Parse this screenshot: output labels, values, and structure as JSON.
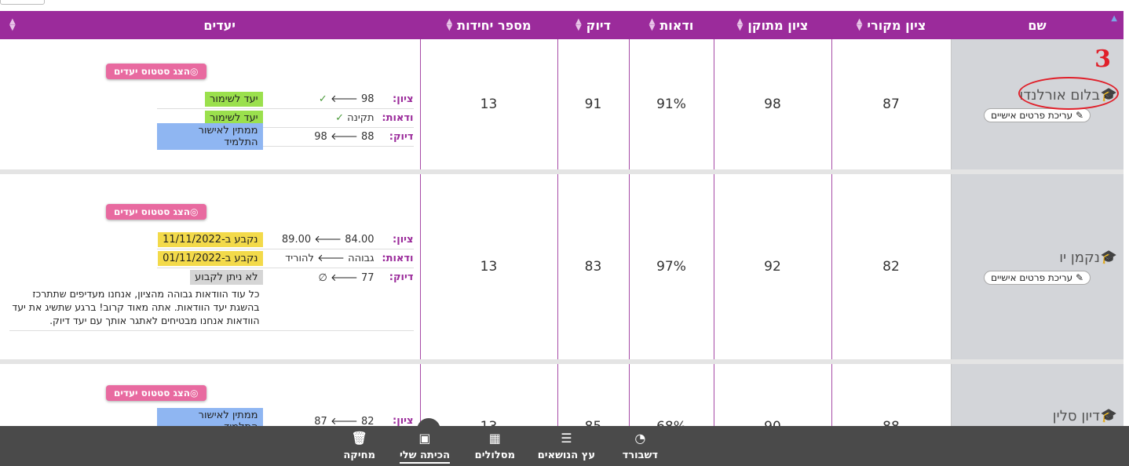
{
  "columns": {
    "name": "שם",
    "orig_grade": "ציון מקורי",
    "fixed_grade": "ציון מתוקן",
    "confidence": "ודאות",
    "accuracy": "דיוק",
    "units": "מספר יחידות",
    "goals": "יעדים"
  },
  "annotation": {
    "rank": "3"
  },
  "common": {
    "edit_btn": "עריכת פרטים אישיים",
    "goals_btn": "הצג סטטוס יעדים",
    "lbl_grade": "ציון:",
    "lbl_conf": "ודאות:",
    "lbl_acc": "דיוק:"
  },
  "students": [
    {
      "name": "בלום אורלנדו",
      "orig": "87",
      "fixed": "98",
      "conf": "91%",
      "acc": "91",
      "units": "13",
      "g_grade_val": "98",
      "g_grade_status": "יעד לשימור",
      "g_conf_val": "תקינה",
      "g_conf_status": "יעד לשימור",
      "g_acc_from": "88",
      "g_acc_to": "98",
      "g_acc_status": "ממתין לאישור התלמיד"
    },
    {
      "name": "נקמן יו",
      "orig": "82",
      "fixed": "92",
      "conf": "97%",
      "acc": "83",
      "units": "13",
      "g_grade_from": "84.00",
      "g_grade_to": "89.00",
      "g_grade_status": "נקבע ב-11/11/2022",
      "g_conf_from": "גבוהה",
      "g_conf_to": "להוריד",
      "g_conf_status": "נקבע ב-01/11/2022",
      "g_acc_from": "77",
      "g_acc_to": "∅",
      "g_acc_status": "לא ניתן לקבוע",
      "g_note": "כל עוד הוודאות גבוהה מהציון, אנחנו מעדיפים שתתרכז בהשגת יעד הוודאות. אתה מאוד קרוב! ברגע שתשיג את יעד הוודאות אנחנו מבטיחים לאתגר אותך עם יעד דיוק."
    },
    {
      "name": "דיון סלין",
      "orig": "88",
      "fixed": "90",
      "conf": "68%",
      "acc": "85",
      "units": "13",
      "g_grade_from": "82",
      "g_grade_to": "87",
      "g_grade_status": "ממתין לאישור התלמיד"
    }
  ],
  "bottom_nav": {
    "dashboard": "דשבורד",
    "topic_tree": "עץ הנושאים",
    "tracks": "מסלולים",
    "my_class": "הכיתה שלי",
    "delete": "מחיקה"
  },
  "colors": {
    "header_bg": "#9b2b9b",
    "name_col_bg": "#d3d5d9",
    "status_green": "#9be04d",
    "status_blue": "#8fb6f2",
    "status_yellow": "#f3da4a",
    "goals_btn": "#e86aa0",
    "bottombar_bg": "#4a4a4a"
  }
}
